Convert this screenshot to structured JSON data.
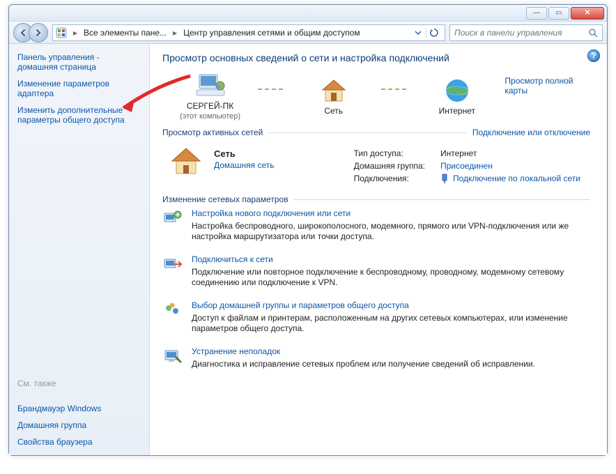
{
  "titlebar": {
    "minimize": "—",
    "maximize": "▭",
    "close": "✕"
  },
  "toolbar": {
    "crumb1": "Все элементы пане...",
    "crumb2": "Центр управления сетями и общим доступом",
    "search_placeholder": "Поиск в панели управления"
  },
  "sidebar": {
    "home": "Панель управления - домашняя страница",
    "link_adapter": "Изменение параметров адаптера",
    "link_sharing": "Изменить дополнительные параметры общего доступа",
    "see_also_title": "См. также",
    "see_also": {
      "firewall": "Брандмауэр Windows",
      "homegroup": "Домашняя группа",
      "browser": "Свойства браузера"
    }
  },
  "content": {
    "title": "Просмотр основных сведений о сети и настройка подключений",
    "map": {
      "pc_name": "СЕРГЕЙ-ПК",
      "pc_sub": "(этот компьютер)",
      "network": "Сеть",
      "internet": "Интернет",
      "full_map_link": "Просмотр полной карты"
    },
    "active_networks": {
      "legend": "Просмотр активных сетей",
      "right_link": "Подключение или отключение",
      "net_name": "Сеть",
      "net_type": "Домашняя сеть",
      "kv": {
        "access_k": "Тип доступа:",
        "access_v": "Интернет",
        "homegroup_k": "Домашняя группа:",
        "homegroup_v": "Присоединен",
        "conn_k": "Подключения:",
        "conn_v": "Подключение по локальной сети"
      }
    },
    "settings_legend": "Изменение сетевых параметров",
    "actions": [
      {
        "title": "Настройка нового подключения или сети",
        "desc": "Настройка беспроводного, широкополосного, модемного, прямого или VPN-подключения или же настройка маршрутизатора или точки доступа."
      },
      {
        "title": "Подключиться к сети",
        "desc": "Подключение или повторное подключение к беспроводному, проводному, модемному сетевому соединению или подключение к VPN."
      },
      {
        "title": "Выбор домашней группы и параметров общего доступа",
        "desc": "Доступ к файлам и принтерам, расположенным на других сетевых компьютерах, или изменение параметров общего доступа."
      },
      {
        "title": "Устранение неполадок",
        "desc": "Диагностика и исправление сетевых проблем или получение сведений об исправлении."
      }
    ]
  }
}
